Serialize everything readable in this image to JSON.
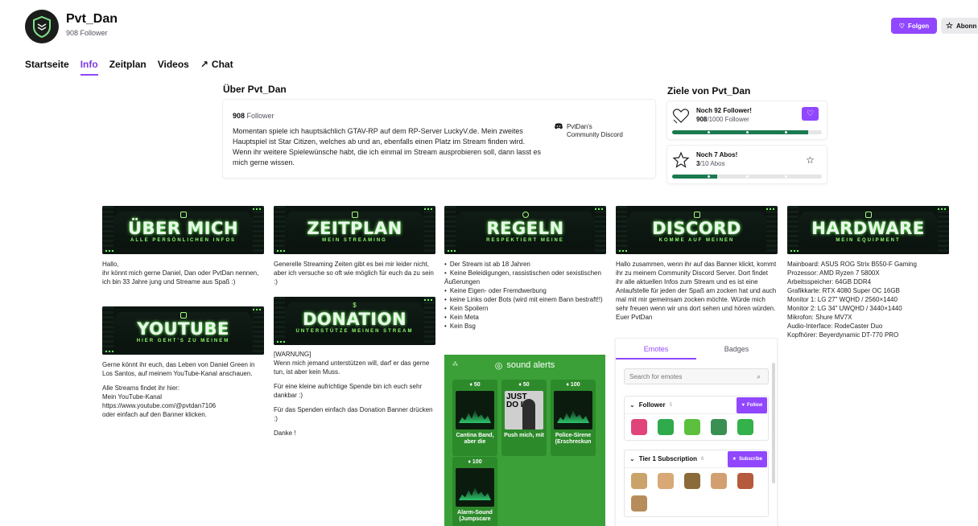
{
  "channel": {
    "name": "Pvt_Dan",
    "followers": "908 Follower",
    "follow_label": "Folgen",
    "subscribe_label": "Abonn"
  },
  "tabs": [
    {
      "label": "Startseite",
      "active": false
    },
    {
      "label": "Info",
      "active": true
    },
    {
      "label": "Zeitplan",
      "active": false
    },
    {
      "label": "Videos",
      "active": false
    },
    {
      "label": "Chat",
      "active": false
    }
  ],
  "about": {
    "title": "Über Pvt_Dan",
    "follower_count": "908",
    "follower_label": "Follower",
    "description": "Momentan spiele ich hauptsächlich GTAV-RP auf dem RP-Server LuckyV.de. Mein zweites Hauptspiel ist Star Citizen, welches ab und an, ebenfalls einen Platz im Stream finden wird. Wenn ihr weitere Spielewünsche habt, die ich einmal im Stream ausprobieren soll, dann lasst es mich gerne wissen.",
    "discord_link_line1": "PvtDan's",
    "discord_link_line2": "Community Discord"
  },
  "goals": {
    "title": "Ziele von Pvt_Dan",
    "items": [
      {
        "headline": "Noch 92 Follower!",
        "current": "908",
        "target_text": "/1000 Follower",
        "progress": 0.908
      },
      {
        "headline": "Noch 7 Abos!",
        "current": "3",
        "target_text": "/10 Abos",
        "progress": 0.3
      }
    ]
  },
  "panels": [
    {
      "title": "ÜBER MICH",
      "subtitle": "ALLE PERSÖNLICHEN INFOS",
      "paragraphs": [
        "Hallo,\nihr könnt mich gerne Daniel, Dan oder PvtDan nennen, ich bin 33 Jahre jung und Streame aus Spaß :)"
      ]
    },
    {
      "title": "ZEITPLAN",
      "subtitle": "MEIN STREAMING",
      "paragraphs": [
        "Generelle Streaming Zeiten gibt es bei mir leider nicht, aber ich versuche so oft wie möglich für euch da zu sein :)"
      ]
    },
    {
      "title": "REGELN",
      "subtitle": "RESPEKTIERT MEINE",
      "bullets": [
        "Der Stream ist ab 18 Jahren",
        "Keine Beleidigungen, rassistischen oder sexistischen Äußerungen",
        "Keine Eigen- oder Fremdwerbung",
        "keine Links oder Bots (wird mit einem Bann bestraft!!)",
        "Kein Spoilern",
        "Kein Meta",
        "Kein Bsg"
      ]
    },
    {
      "title": "DISCORD",
      "subtitle": "KOMME AUF MEINEN",
      "paragraphs": [
        "Hallo zusammen, wenn ihr auf das Banner klickt, kommt ihr zu meinem Community Discord Server. Dort findet ihr alle aktuellen Infos zum Stream und es ist eine Anlaufstelle für jeden der Spaß am zocken hat und auch mal mit mir gemeinsam zocken möchte. Würde mich sehr freuen wenn wir uns dort sehen und hören würden. Euer PvtDan"
      ]
    },
    {
      "title": "HARDWARE",
      "subtitle": "MEIN EQUIPMENT",
      "lines": [
        "Mainboard: ASUS ROG Strix B550-F Gaming",
        "Prozessor: AMD Ryzen 7 5800X",
        "Arbeitsspeicher: 64GB DDR4",
        "Grafikkarte: RTX 4080 Super OC 16GB",
        "Monitor 1: LG 27\" WQHD / 2560×1440",
        "Monitor 2: LG 34\" UWQHD / 3440×1440",
        "Mikrofon: Shure MV7X",
        "Audio-Interface: RodeCaster Duo",
        "Kopfhörer: Beyerdynamic DT-770 PRO"
      ]
    },
    {
      "title": "YOUTUBE",
      "subtitle": "HIER GEHT'S ZU MEINEM",
      "paragraphs": [
        "Gerne könnt ihr euch, das Leben von Daniel Green in Los Santos, auf meinem YouTube-Kanal anschauen.",
        "Alle Streams findet ihr hier:\nMein YouTube-Kanal\nhttps://www.youtube.com/@pvtdan7106\noder einfach auf den Banner klicken."
      ]
    },
    {
      "title": "DONATION",
      "subtitle": "UNTERSTÜTZE MEINEN STREAM",
      "paragraphs": [
        "[WARNUNG]\nWenn mich jemand unterstützen will, darf er das gerne tun, ist aber kein Muss.",
        "Für eine kleine aufrichtige Spende bin ich euch sehr dankbar :)",
        "Für das Spenden einfach das Donation Banner drücken :)",
        "Danke !"
      ]
    }
  ],
  "sound_alerts": {
    "title": "sound alerts",
    "items": [
      {
        "price": "50",
        "label": "Cantina Band, aber die"
      },
      {
        "price": "50",
        "label": "Push mich, mit",
        "thumb_text": "JUST DO IT!"
      },
      {
        "price": "100",
        "label": "Police-Sirene (Erschreckun"
      },
      {
        "price": "100",
        "label": "Alarm-Sound (Jumpscare"
      }
    ]
  },
  "emotes": {
    "tabs": [
      "Emotes",
      "Badges"
    ],
    "search_placeholder": "Search for emotes",
    "sections": [
      {
        "name": "Follower",
        "count": "5",
        "button": "Follow",
        "colors": [
          "#e0447a",
          "#2faa4c",
          "#5dbf3e",
          "#3a8f52",
          "#33b14a"
        ]
      },
      {
        "name": "Tier 1 Subscription",
        "count": "6",
        "button": "Subscribe",
        "colors": [
          "#c9a36a",
          "#d9a877",
          "#8c6b3a",
          "#d2a070",
          "#b55a3c",
          "#b78c5c"
        ]
      }
    ]
  },
  "colors": {
    "accent": "#9147ff",
    "goal_progress": "#1a7a50",
    "panel_glow": "#6cff5c",
    "sound_alerts_bg": "#3aa037"
  }
}
